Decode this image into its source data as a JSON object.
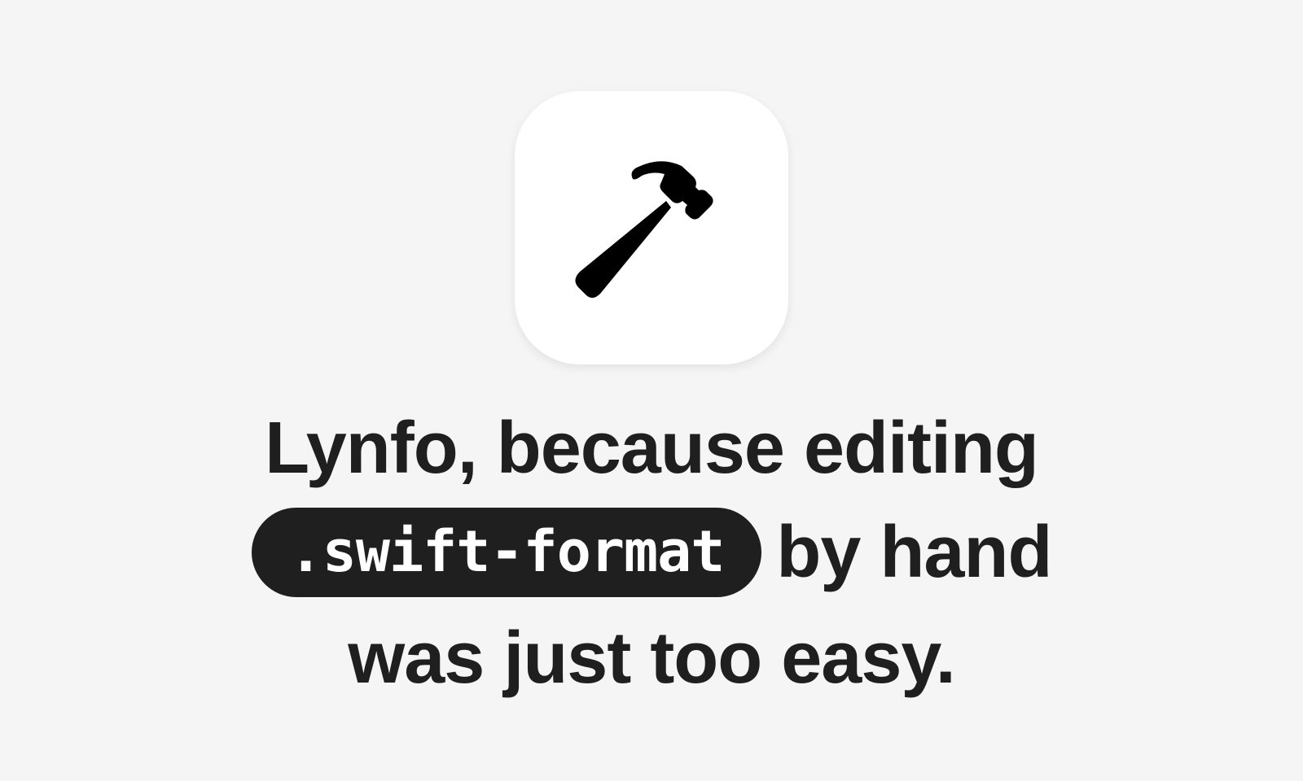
{
  "icon": "hammer-icon",
  "headline": {
    "line1": "Lynfo, because editing",
    "code": ".swift-format",
    "line2_rest": "by hand",
    "line3": "was just too easy."
  }
}
